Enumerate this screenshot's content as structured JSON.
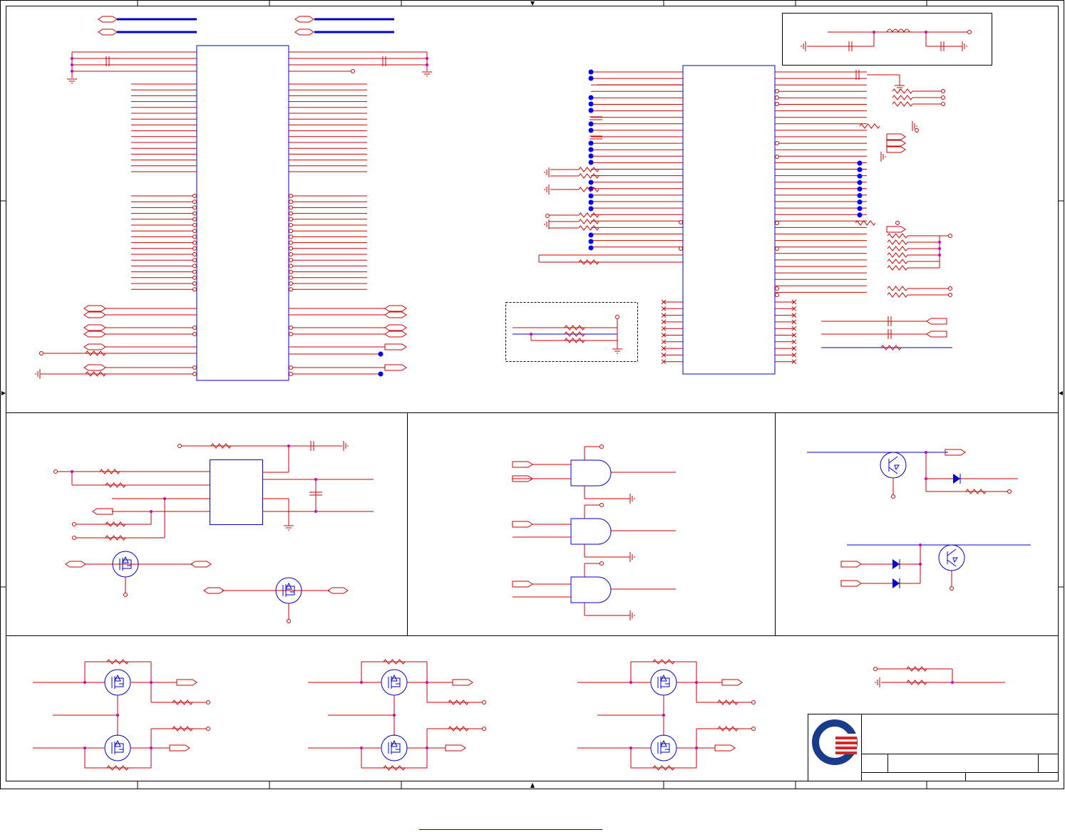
{
  "colors": {
    "wire": "#cc0000",
    "component": "#0000cc",
    "no_connect_dot": "#0000ff",
    "junction": "#d000d0",
    "frame": "#000000",
    "logo_blue": "#1a3a8c",
    "logo_red": "#d62828"
  },
  "icons": {
    "logo": "company-logo-icon",
    "resistor": "resistor-icon",
    "capacitor": "capacitor-icon",
    "inductor": "inductor-icon",
    "ground": "ground-icon",
    "mosfet": "mosfet-icon",
    "transistor": "transistor-icon",
    "diode": "diode-icon",
    "and_gate": "and-gate-icon",
    "off_page_connector": "off-page-connector-icon"
  }
}
